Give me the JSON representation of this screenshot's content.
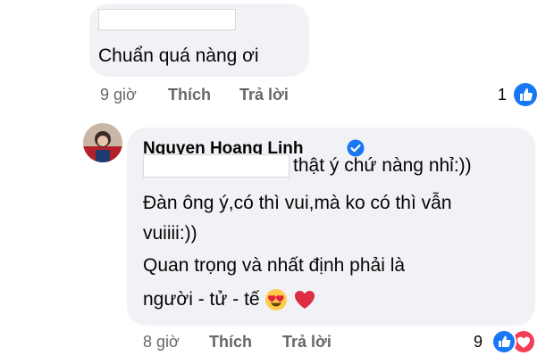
{
  "comment1": {
    "text": "Chuẩn quá nàng ơi",
    "time": "9 giờ",
    "like_label": "Thích",
    "reply_label": "Trả lời",
    "reaction_count": "1",
    "reactions": [
      "like-icon"
    ]
  },
  "comment2": {
    "author": "Nguyen Hoang Linh",
    "verified": true,
    "lines": [
      "thật ý chứ nàng nhỉ:))",
      "Đàn ông ý,có thì vui,mà ko có thì vẫn",
      "vuiiii:))",
      "Quan trọng và nhất định phải là",
      "người - tử - tế"
    ],
    "emojis": [
      "heart-eyes-emoji",
      "red-heart-emoji"
    ],
    "time": "8 giờ",
    "like_label": "Thích",
    "reply_label": "Trả lời",
    "reaction_count": "9",
    "reactions": [
      "like-icon",
      "love-icon"
    ]
  },
  "colors": {
    "bubble": "#f0f2f5",
    "meta_text": "#65676b",
    "like_blue": "#1877f2",
    "love_red": "#f33e58"
  }
}
